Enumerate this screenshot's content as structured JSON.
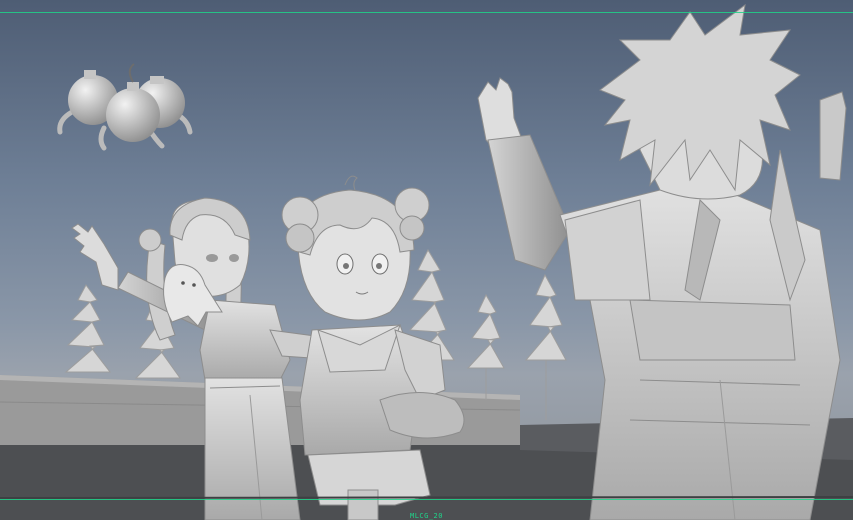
{
  "viewport": {
    "hud_label": "MLCG_20",
    "gate_color": "#1fd48a",
    "model_color": "#c8c8c8",
    "floor_color": "#4d4f52",
    "sky_top": "#4e5d74",
    "sky_bottom": "#9aa2ad"
  },
  "scene_objects": [
    "floating-bomb-creatures",
    "girl-waving-with-ghost",
    "girl-with-hair-buns",
    "boy-raising-hand",
    "stylized-trees",
    "low-wall",
    "floor-plane"
  ]
}
